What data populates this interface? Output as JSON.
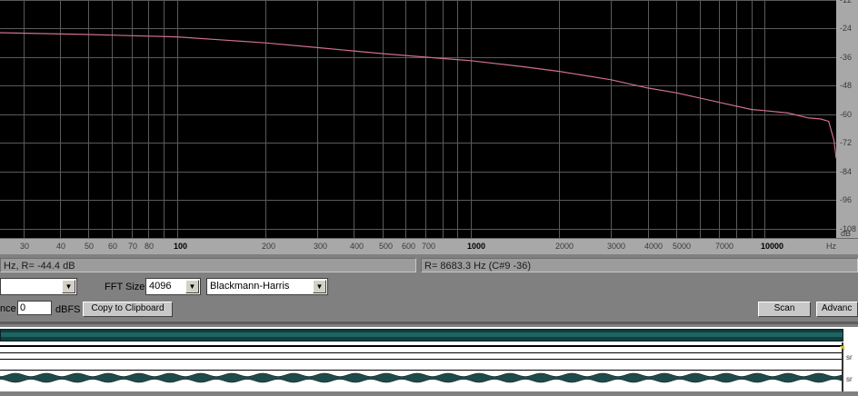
{
  "colors": {
    "plot_bg": "#000000",
    "grid": "#5a5a5a",
    "curve": "#d0708c",
    "panel": "#808080"
  },
  "chart_data": {
    "type": "line",
    "x_scale": "log",
    "xlim": [
      25,
      17500
    ],
    "ylim": [
      -112,
      -12
    ],
    "y_ticks": [
      -12,
      -24,
      -36,
      -48,
      -60,
      -72,
      -84,
      -96,
      -108
    ],
    "y_tick_labels": [
      "-12",
      "-24",
      "-36",
      "-48",
      "-60",
      "-72",
      "-84",
      "-96",
      "-108"
    ],
    "x_ticks": [
      30,
      40,
      50,
      60,
      70,
      80,
      100,
      200,
      300,
      400,
      500,
      600,
      700,
      1000,
      2000,
      3000,
      4000,
      5000,
      7000,
      10000
    ],
    "x_tick_labels": [
      "30",
      "40",
      "50",
      "60",
      "70",
      "80",
      "100",
      "200",
      "300",
      "400",
      "500",
      "600",
      "700",
      "1000",
      "2000",
      "3000",
      "4000",
      "5000",
      "7000",
      "10000"
    ],
    "major_x_ticks": [
      100,
      1000,
      10000
    ],
    "x_unit_label": "Hz",
    "y_unit_label": "dB",
    "grid": true,
    "series": [
      {
        "x": [
          20,
          50,
          100,
          200,
          300,
          500,
          700,
          1000,
          1500,
          2000,
          3000,
          4000,
          5000,
          7000,
          9000,
          10000,
          12000,
          14000,
          15500,
          16500,
          17200,
          17500
        ],
        "y": [
          -25.5,
          -26.5,
          -27.5,
          -30.0,
          -32.0,
          -34.5,
          -36.0,
          -37.5,
          -40.0,
          -42.0,
          -45.5,
          -49.0,
          -51.0,
          -55.0,
          -58.0,
          -58.5,
          -59.5,
          -61.5,
          -62.0,
          -63.0,
          -71.0,
          -78.5
        ]
      }
    ]
  },
  "status": {
    "left_readout": "Hz, R= -44.4 dB",
    "right_readout": "R= 8683.3 Hz (C#9 -36)"
  },
  "controls": {
    "fft_size_label": "FFT Size",
    "fft_size_value": "4096",
    "window_value": "Blackmann-Harris",
    "reference_label": "nce",
    "reference_value": "0",
    "dbfs_label": "dBFS",
    "copy_button": "Copy to Clipboard",
    "scan_button": "Scan",
    "advanced_button": "Advanc"
  },
  "overview": {
    "side_label_1": "sr",
    "side_label_2": "sr"
  }
}
